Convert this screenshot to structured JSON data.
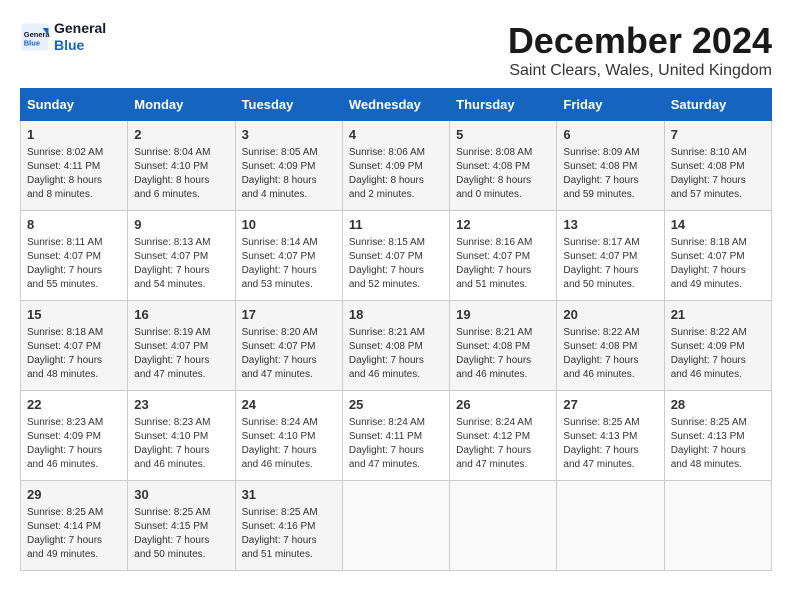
{
  "header": {
    "logo_line1": "General",
    "logo_line2": "Blue",
    "title": "December 2024",
    "subtitle": "Saint Clears, Wales, United Kingdom"
  },
  "days_of_week": [
    "Sunday",
    "Monday",
    "Tuesday",
    "Wednesday",
    "Thursday",
    "Friday",
    "Saturday"
  ],
  "weeks": [
    [
      {
        "day": "1",
        "info": "Sunrise: 8:02 AM\nSunset: 4:11 PM\nDaylight: 8 hours\nand 8 minutes."
      },
      {
        "day": "2",
        "info": "Sunrise: 8:04 AM\nSunset: 4:10 PM\nDaylight: 8 hours\nand 6 minutes."
      },
      {
        "day": "3",
        "info": "Sunrise: 8:05 AM\nSunset: 4:09 PM\nDaylight: 8 hours\nand 4 minutes."
      },
      {
        "day": "4",
        "info": "Sunrise: 8:06 AM\nSunset: 4:09 PM\nDaylight: 8 hours\nand 2 minutes."
      },
      {
        "day": "5",
        "info": "Sunrise: 8:08 AM\nSunset: 4:08 PM\nDaylight: 8 hours\nand 0 minutes."
      },
      {
        "day": "6",
        "info": "Sunrise: 8:09 AM\nSunset: 4:08 PM\nDaylight: 7 hours\nand 59 minutes."
      },
      {
        "day": "7",
        "info": "Sunrise: 8:10 AM\nSunset: 4:08 PM\nDaylight: 7 hours\nand 57 minutes."
      }
    ],
    [
      {
        "day": "8",
        "info": "Sunrise: 8:11 AM\nSunset: 4:07 PM\nDaylight: 7 hours\nand 55 minutes."
      },
      {
        "day": "9",
        "info": "Sunrise: 8:13 AM\nSunset: 4:07 PM\nDaylight: 7 hours\nand 54 minutes."
      },
      {
        "day": "10",
        "info": "Sunrise: 8:14 AM\nSunset: 4:07 PM\nDaylight: 7 hours\nand 53 minutes."
      },
      {
        "day": "11",
        "info": "Sunrise: 8:15 AM\nSunset: 4:07 PM\nDaylight: 7 hours\nand 52 minutes."
      },
      {
        "day": "12",
        "info": "Sunrise: 8:16 AM\nSunset: 4:07 PM\nDaylight: 7 hours\nand 51 minutes."
      },
      {
        "day": "13",
        "info": "Sunrise: 8:17 AM\nSunset: 4:07 PM\nDaylight: 7 hours\nand 50 minutes."
      },
      {
        "day": "14",
        "info": "Sunrise: 8:18 AM\nSunset: 4:07 PM\nDaylight: 7 hours\nand 49 minutes."
      }
    ],
    [
      {
        "day": "15",
        "info": "Sunrise: 8:18 AM\nSunset: 4:07 PM\nDaylight: 7 hours\nand 48 minutes."
      },
      {
        "day": "16",
        "info": "Sunrise: 8:19 AM\nSunset: 4:07 PM\nDaylight: 7 hours\nand 47 minutes."
      },
      {
        "day": "17",
        "info": "Sunrise: 8:20 AM\nSunset: 4:07 PM\nDaylight: 7 hours\nand 47 minutes."
      },
      {
        "day": "18",
        "info": "Sunrise: 8:21 AM\nSunset: 4:08 PM\nDaylight: 7 hours\nand 46 minutes."
      },
      {
        "day": "19",
        "info": "Sunrise: 8:21 AM\nSunset: 4:08 PM\nDaylight: 7 hours\nand 46 minutes."
      },
      {
        "day": "20",
        "info": "Sunrise: 8:22 AM\nSunset: 4:08 PM\nDaylight: 7 hours\nand 46 minutes."
      },
      {
        "day": "21",
        "info": "Sunrise: 8:22 AM\nSunset: 4:09 PM\nDaylight: 7 hours\nand 46 minutes."
      }
    ],
    [
      {
        "day": "22",
        "info": "Sunrise: 8:23 AM\nSunset: 4:09 PM\nDaylight: 7 hours\nand 46 minutes."
      },
      {
        "day": "23",
        "info": "Sunrise: 8:23 AM\nSunset: 4:10 PM\nDaylight: 7 hours\nand 46 minutes."
      },
      {
        "day": "24",
        "info": "Sunrise: 8:24 AM\nSunset: 4:10 PM\nDaylight: 7 hours\nand 46 minutes."
      },
      {
        "day": "25",
        "info": "Sunrise: 8:24 AM\nSunset: 4:11 PM\nDaylight: 7 hours\nand 47 minutes."
      },
      {
        "day": "26",
        "info": "Sunrise: 8:24 AM\nSunset: 4:12 PM\nDaylight: 7 hours\nand 47 minutes."
      },
      {
        "day": "27",
        "info": "Sunrise: 8:25 AM\nSunset: 4:13 PM\nDaylight: 7 hours\nand 47 minutes."
      },
      {
        "day": "28",
        "info": "Sunrise: 8:25 AM\nSunset: 4:13 PM\nDaylight: 7 hours\nand 48 minutes."
      }
    ],
    [
      {
        "day": "29",
        "info": "Sunrise: 8:25 AM\nSunset: 4:14 PM\nDaylight: 7 hours\nand 49 minutes."
      },
      {
        "day": "30",
        "info": "Sunrise: 8:25 AM\nSunset: 4:15 PM\nDaylight: 7 hours\nand 50 minutes."
      },
      {
        "day": "31",
        "info": "Sunrise: 8:25 AM\nSunset: 4:16 PM\nDaylight: 7 hours\nand 51 minutes."
      },
      {
        "day": "",
        "info": ""
      },
      {
        "day": "",
        "info": ""
      },
      {
        "day": "",
        "info": ""
      },
      {
        "day": "",
        "info": ""
      }
    ]
  ]
}
